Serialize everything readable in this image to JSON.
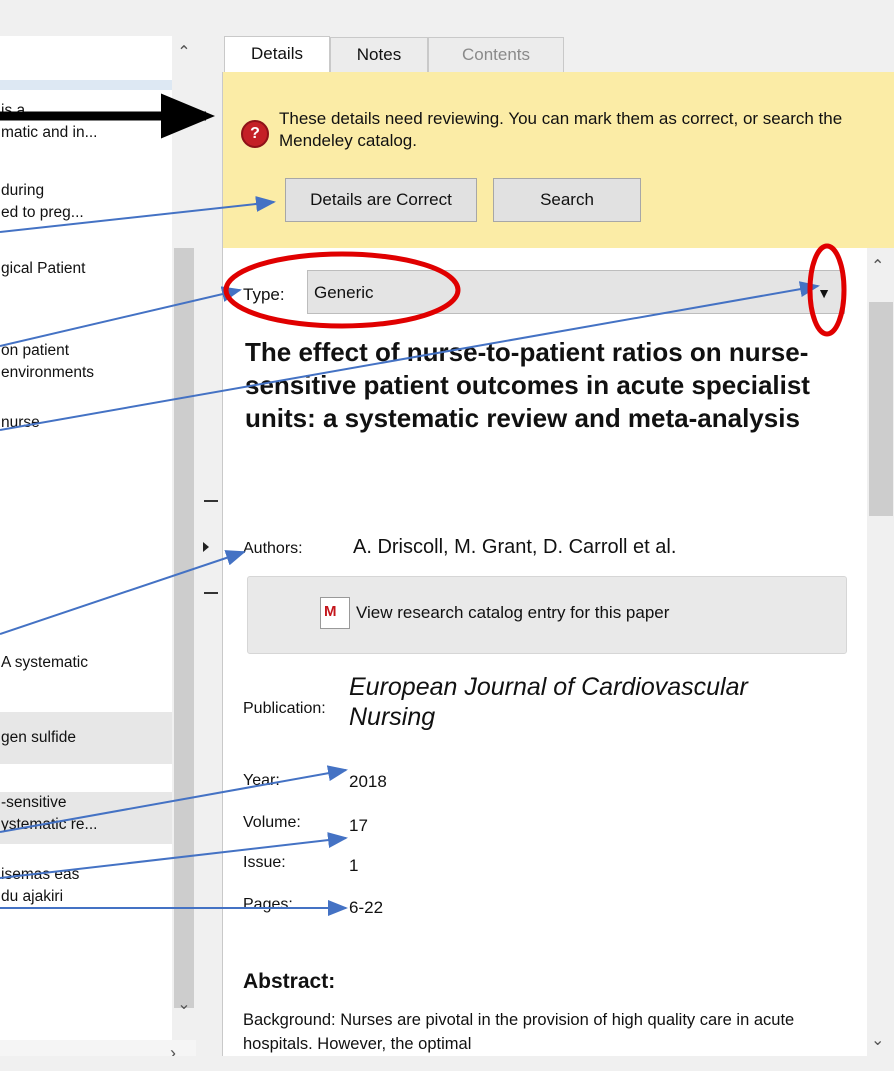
{
  "left_list": {
    "rows": [
      {
        "line1": "is a",
        "line2": "matic and in..."
      },
      {
        "line1": "during",
        "line2": "ed to preg..."
      },
      {
        "line1": "gical Patient",
        "line2": ""
      },
      {
        "line1": "on patient",
        "line2": "environments"
      },
      {
        "line1": "nurse",
        "line2": ""
      },
      {
        "line1": "A systematic",
        "line2": ""
      },
      {
        "line1": "gen sulfide",
        "line2": ""
      },
      {
        "line1": "-sensitive",
        "line2": "ystematic re..."
      },
      {
        "line1": "isemas eas",
        "line2": "du ajakiri"
      }
    ]
  },
  "tabs": [
    "Details",
    "Notes",
    "Contents"
  ],
  "notice": {
    "text": "These details need reviewing. You can mark them as correct, or search the Mendeley catalog.",
    "correct_button": "Details are Correct",
    "search_button": "Search"
  },
  "type": {
    "label": "Type:",
    "value": "Generic"
  },
  "paper": {
    "title": "The effect of nurse-to-patient ratios on nurse-sensitive patient outcomes in acute specialist units: a systematic review and meta-analysis",
    "authors_label": "Authors:",
    "authors": "A. Driscoll, M. Grant, D. Carroll et al.",
    "catalog_link": "View research catalog entry for this paper",
    "publication_label": "Publication:",
    "publication": "European Journal of Cardiovascular Nursing",
    "year_label": "Year:",
    "year": "2018",
    "volume_label": "Volume:",
    "volume": "17",
    "issue_label": "Issue:",
    "issue": "1",
    "pages_label": "Pages:",
    "pages": "6-22",
    "abstract_heading": "Abstract:",
    "abstract": "Background: Nurses are pivotal in the provision of high quality care in acute hospitals. However, the optimal"
  },
  "colors": {
    "notice_bg": "#fbeca6",
    "annotation_arrow": "#4472c4",
    "annotation_circle": "#e00000"
  }
}
